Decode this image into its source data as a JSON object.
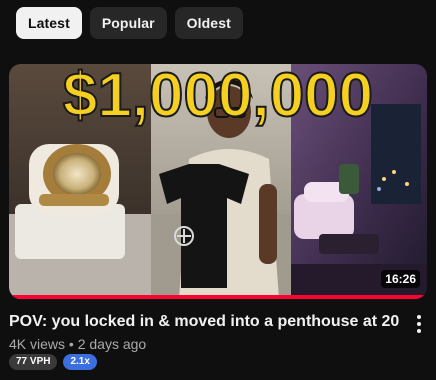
{
  "filters": [
    {
      "label": "Latest",
      "active": true
    },
    {
      "label": "Popular",
      "active": false
    },
    {
      "label": "Oldest",
      "active": false
    }
  ],
  "video": {
    "thumbnail_text": "$1,000,000",
    "duration": "16:26",
    "watch_progress": 1.0,
    "title": "POV: you locked in & moved into a penthouse at 20",
    "views": "4K views",
    "separator": "•",
    "age": "2 days ago",
    "vph_badge": "77 VPH",
    "multiplier_badge": "2.1x"
  },
  "colors": {
    "accent_red": "#ff0033",
    "badge_blue": "#3b6fe0",
    "headline_yellow": "#f5d020"
  }
}
